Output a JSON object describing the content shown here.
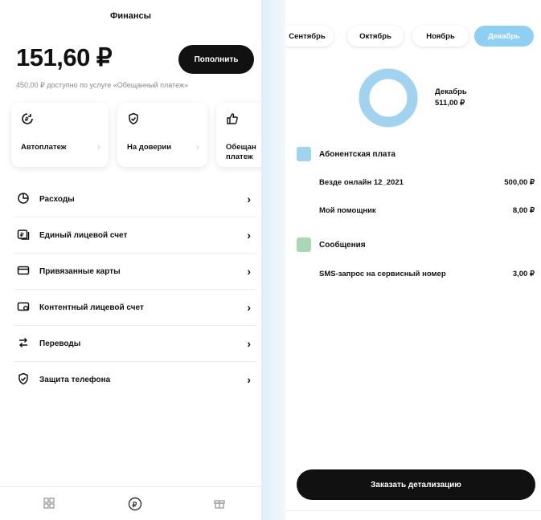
{
  "left": {
    "title": "Финансы",
    "balance": "151,60 ₽",
    "topup_label": "Пополнить",
    "available_text": "450,00 ₽ доступно по услуге «Обещанный платеж»",
    "cards": [
      {
        "label_line1": "Автоплатеж",
        "label_line2": "",
        "icon": "autopay-icon"
      },
      {
        "label_line1": "На доверии",
        "label_line2": "",
        "icon": "shield-check-icon"
      },
      {
        "label_line1": "Обещан",
        "label_line2": "платеж",
        "icon": "thumbs-up-icon"
      }
    ],
    "menu": [
      {
        "label": "Расходы",
        "icon": "pie-chart-icon"
      },
      {
        "label": "Единый лицевой счет",
        "icon": "ruble-account-icon"
      },
      {
        "label": "Привязанные карты",
        "icon": "card-icon"
      },
      {
        "label": "Контентный лицевой счет",
        "icon": "content-account-icon"
      },
      {
        "label": "Переводы",
        "icon": "transfer-icon"
      },
      {
        "label": "Защита телефона",
        "icon": "shield-icon"
      }
    ],
    "bottom_nav": [
      "grid-icon",
      "ruble-icon",
      "gift-icon"
    ]
  },
  "right": {
    "months": [
      "Сентябрь",
      "Октябрь",
      "Ноябрь",
      "Декабрь"
    ],
    "active_month": "Декабрь",
    "donut_label": "Декабрь",
    "donut_total": "511,00 ₽",
    "sections": [
      {
        "title": "Абонентская плата",
        "color": "#9fd3ef",
        "rows": [
          {
            "name": "Везде онлайн 12_2021",
            "amount": "500,00 ₽"
          },
          {
            "name": "Мой помощник",
            "amount": "8,00 ₽"
          }
        ]
      },
      {
        "title": "Сообщения",
        "color": "#a8d8b4",
        "rows": [
          {
            "name": "SMS-запрос на сервисный номер",
            "amount": "3,00 ₽"
          }
        ]
      }
    ],
    "order_label": "Заказать детализацию"
  },
  "colors": {
    "accent": "#8ed0f3",
    "dark": "#111111"
  }
}
